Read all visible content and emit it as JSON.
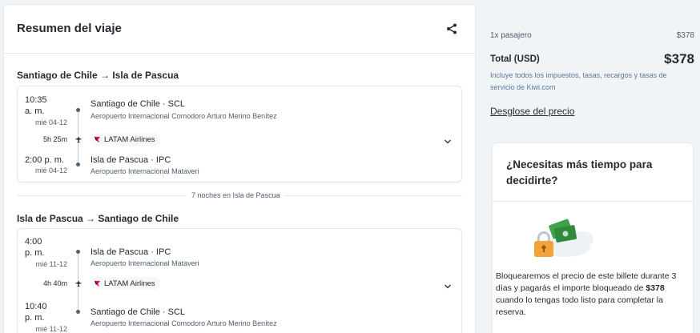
{
  "summary": {
    "title": "Resumen del viaje",
    "outbound": {
      "route": "Santiago de Chile → Isla de Pascua",
      "dep_time_1": "10:35",
      "dep_time_2": "a. m.",
      "dep_date": "mié 04-12",
      "dep_place": "Santiago de Chile · SCL",
      "dep_airport": "Aeropuerto Internacional Comodoro Arturo Merino Benítez",
      "duration": "5h 25m",
      "airline": "LATAM Airlines",
      "arr_time": "2:00 p. m.",
      "arr_date": "mié 04-12",
      "arr_place": "Isla de Pascua · IPC",
      "arr_airport": "Aeropuerto Internacional Mataveri"
    },
    "nights": "7 noches en Isla de Pascua",
    "inbound": {
      "route": "Isla de Pascua → Santiago de Chile",
      "dep_time_1": "4:00",
      "dep_time_2": "p. m.",
      "dep_date": "mié 11-12",
      "dep_place": "Isla de Pascua · IPC",
      "dep_airport": "Aeropuerto Internacional Mataveri",
      "duration": "4h 40m",
      "airline": "LATAM Airlines",
      "arr_time_1": "10:40",
      "arr_time_2": "p. m.",
      "arr_date": "mié 11-12",
      "arr_place": "Santiago de Chile · SCL",
      "arr_airport": "Aeropuerto Internacional Comodoro Arturo Merino Benítez"
    }
  },
  "pricing": {
    "passengers_label": "1x pasajero",
    "passengers_price": "$378",
    "total_label": "Total (USD)",
    "total_price": "$378",
    "tax_note": "Incluye todos los impuestos, tasas, recargos y tasas de servicio de Kiwi.com",
    "breakdown_link": "Desglose del precio"
  },
  "promo": {
    "title": "¿Necesitas más tiempo para decidirte?",
    "text_1": "Bloquearemos el precio de este billete durante 3 días y pagarás el importe bloqueado de ",
    "text_bold": "$378",
    "text_2": " cuando lo tengas todo listo para completar la reserva."
  },
  "colors": {
    "accent_link": "#5a7895",
    "latam_logo": "#e8114b",
    "lock": "#f3a33a",
    "money": "#3fa34d"
  }
}
